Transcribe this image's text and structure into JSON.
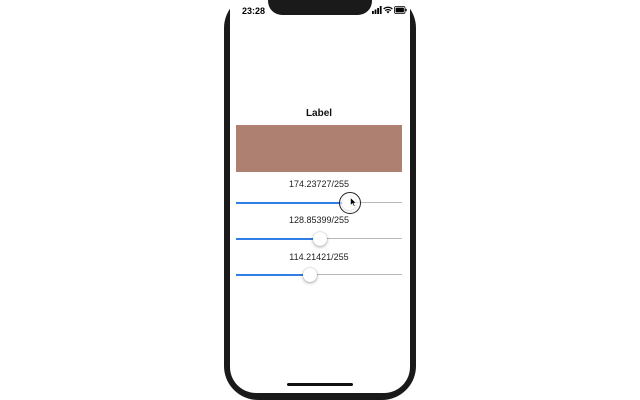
{
  "status_bar": {
    "time": "23:28",
    "icons": [
      "signal-icon",
      "wifi-icon",
      "battery-icon"
    ]
  },
  "main": {
    "title": "Label",
    "preview_color": "#ae8072",
    "sliders": [
      {
        "label": "174.23727/255",
        "value": 174.23727,
        "max": 255,
        "active": true
      },
      {
        "label": "128.85399/255",
        "value": 128.85399,
        "max": 255,
        "active": false
      },
      {
        "label": "114.21421/255",
        "value": 114.21421,
        "max": 255,
        "active": false
      }
    ]
  },
  "colors": {
    "track_fill": "#2f7fe6",
    "track_bg": "#b8b8b8",
    "device_frame": "#1a1a1a"
  }
}
